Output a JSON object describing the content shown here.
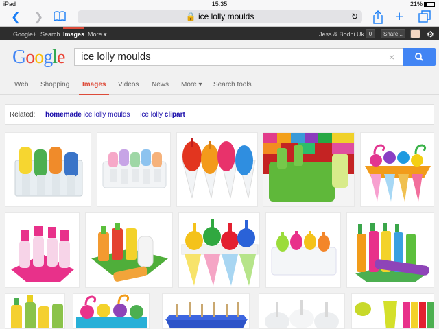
{
  "status_bar": {
    "device": "iPad",
    "time": "15:35",
    "battery": "21%"
  },
  "browser": {
    "url_text": "ice lolly moulds"
  },
  "google_bar": {
    "links": [
      "Google+",
      "Search",
      "Images",
      "More ▾"
    ],
    "user": "Jess & Bodhi Uk",
    "notif_count": "0",
    "share": "Share..."
  },
  "search": {
    "logo": "Google",
    "query": "ice lolly moulds",
    "clear": "×"
  },
  "tabs": [
    "Web",
    "Shopping",
    "Images",
    "Videos",
    "News",
    "More ▾",
    "Search tools"
  ],
  "related": {
    "label": "Related:",
    "s1_bold": "homemade",
    "s1_rest": " ice lolly moulds",
    "s2_rest": "ice lolly ",
    "s2_bold": "clipart"
  },
  "colors": {
    "accent": "#dd4b39",
    "link": "#1a0dab",
    "search_button": "#4285f4"
  },
  "results": {
    "images": [
      "ice-lolly-mould-image-1",
      "ice-lolly-mould-image-2",
      "ice-lolly-mould-image-3",
      "ice-lolly-mould-image-4",
      "ice-lolly-mould-image-5",
      "ice-lolly-mould-image-6",
      "ice-lolly-mould-image-7",
      "ice-lolly-mould-image-8",
      "ice-lolly-mould-image-9",
      "ice-lolly-mould-image-10",
      "ice-lolly-mould-image-11",
      "ice-lolly-mould-image-12",
      "ice-lolly-mould-image-13",
      "ice-lolly-mould-image-14",
      "ice-lolly-mould-image-15"
    ]
  }
}
